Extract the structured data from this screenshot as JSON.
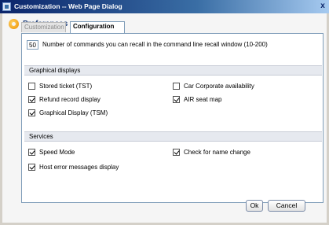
{
  "window": {
    "title": "Customization -- Web Page Dialog",
    "close_label": "x"
  },
  "header": {
    "title": "Preferences"
  },
  "tabs": [
    {
      "label": "Customization",
      "active": false
    },
    {
      "label": "Configuration",
      "active": true
    }
  ],
  "recall": {
    "value": "50",
    "label": "Number of commands you can recall in the command line recall window (10-200)"
  },
  "graphical": {
    "title": "Graphical displays",
    "items": [
      {
        "label": "Stored ticket (TST)",
        "checked": false
      },
      {
        "label": "Car Corporate availability",
        "checked": false
      },
      {
        "label": "Refund record display",
        "checked": true
      },
      {
        "label": "AIR seat map",
        "checked": true
      },
      {
        "label": "Graphical Display (TSM)",
        "checked": true
      }
    ]
  },
  "services": {
    "title": "Services",
    "items": [
      {
        "label": "Speed Mode",
        "checked": true
      },
      {
        "label": "Check for name change",
        "checked": true
      },
      {
        "label": "Host error messages display",
        "checked": true
      }
    ]
  },
  "buttons": {
    "ok": "Ok",
    "cancel": "Cancel"
  },
  "colors": {
    "titlebar": "#0a246a",
    "header_text": "#1f3f7a",
    "section_bg": "#e6e9ef"
  }
}
